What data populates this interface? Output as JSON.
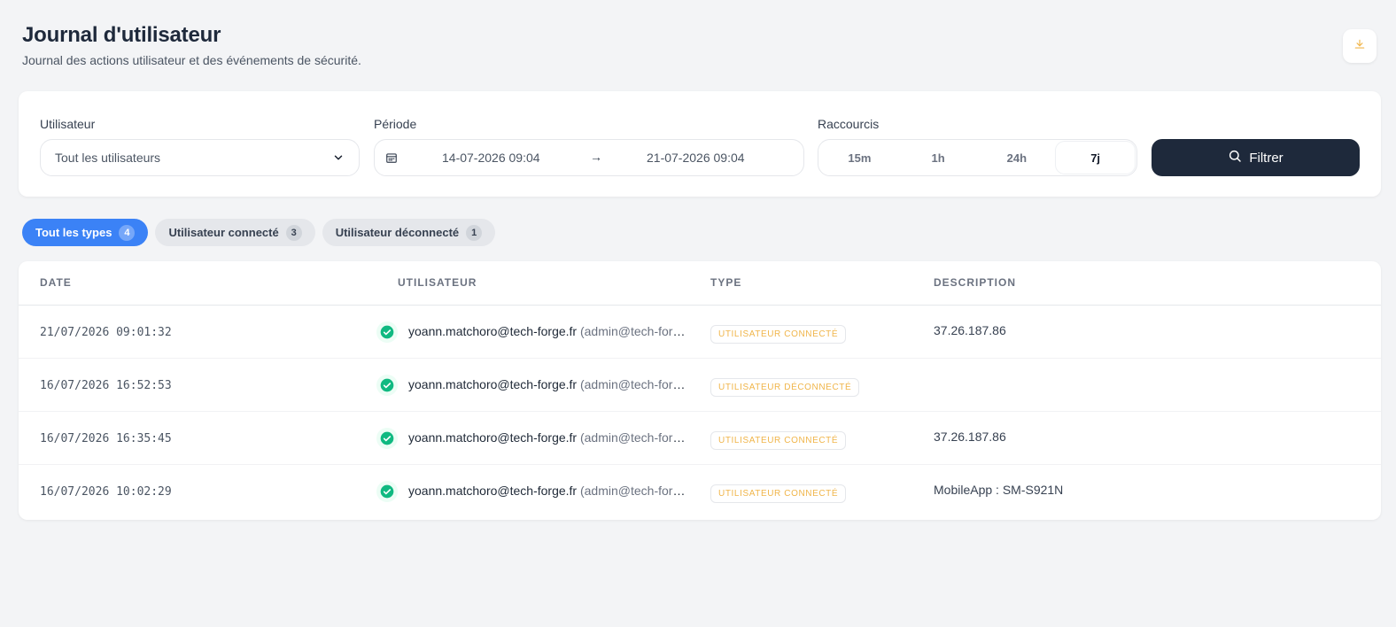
{
  "header": {
    "title": "Journal d'utilisateur",
    "subtitle": "Journal des actions utilisateur et des événements de sécurité."
  },
  "icons": {
    "download": "download-icon",
    "chevron": "chevron-down-icon",
    "calendar": "calendar-icon",
    "search": "search-icon",
    "check": "check-circle-icon"
  },
  "colors": {
    "accent": "#3b82f6",
    "dark": "#1e293b",
    "success": "#10b981",
    "badge_text": "#f0b54a"
  },
  "filters": {
    "user_label": "Utilisateur",
    "user_value": "Tout les utilisateurs",
    "period_label": "Période",
    "period_start": "14-07-2026 09:04",
    "period_arrow": "→",
    "period_end": "21-07-2026 09:04",
    "shortcuts_label": "Raccourcis",
    "shortcuts": [
      "15m",
      "1h",
      "24h",
      "7j"
    ],
    "active_shortcut": "7j",
    "filter_button": "Filtrer"
  },
  "chips": [
    {
      "label": "Tout les types",
      "count": "4",
      "active": true
    },
    {
      "label": "Utilisateur connecté",
      "count": "3",
      "active": false
    },
    {
      "label": "Utilisateur déconnecté",
      "count": "1",
      "active": false
    }
  ],
  "table": {
    "headers": [
      "DATE",
      "UTILISATEUR",
      "TYPE",
      "DESCRIPTION"
    ],
    "rows": [
      {
        "date": "21/07/2026 09:01:32",
        "email": "yoann.matchoro@tech-forge.fr",
        "extra": "(admin@tech-forge.fr)",
        "type": "UTILISATEUR CONNECTÉ",
        "description": "37.26.187.86"
      },
      {
        "date": "16/07/2026 16:52:53",
        "email": "yoann.matchoro@tech-forge.fr",
        "extra": "(admin@tech-forge.fr)",
        "type": "UTILISATEUR DÉCONNECTÉ",
        "description": ""
      },
      {
        "date": "16/07/2026 16:35:45",
        "email": "yoann.matchoro@tech-forge.fr",
        "extra": "(admin@tech-forge.fr)",
        "type": "UTILISATEUR CONNECTÉ",
        "description": "37.26.187.86"
      },
      {
        "date": "16/07/2026 10:02:29",
        "email": "yoann.matchoro@tech-forge.fr",
        "extra": "(admin@tech-forge.fr)",
        "type": "UTILISATEUR CONNECTÉ",
        "description": "MobileApp : SM-S921N"
      }
    ]
  }
}
